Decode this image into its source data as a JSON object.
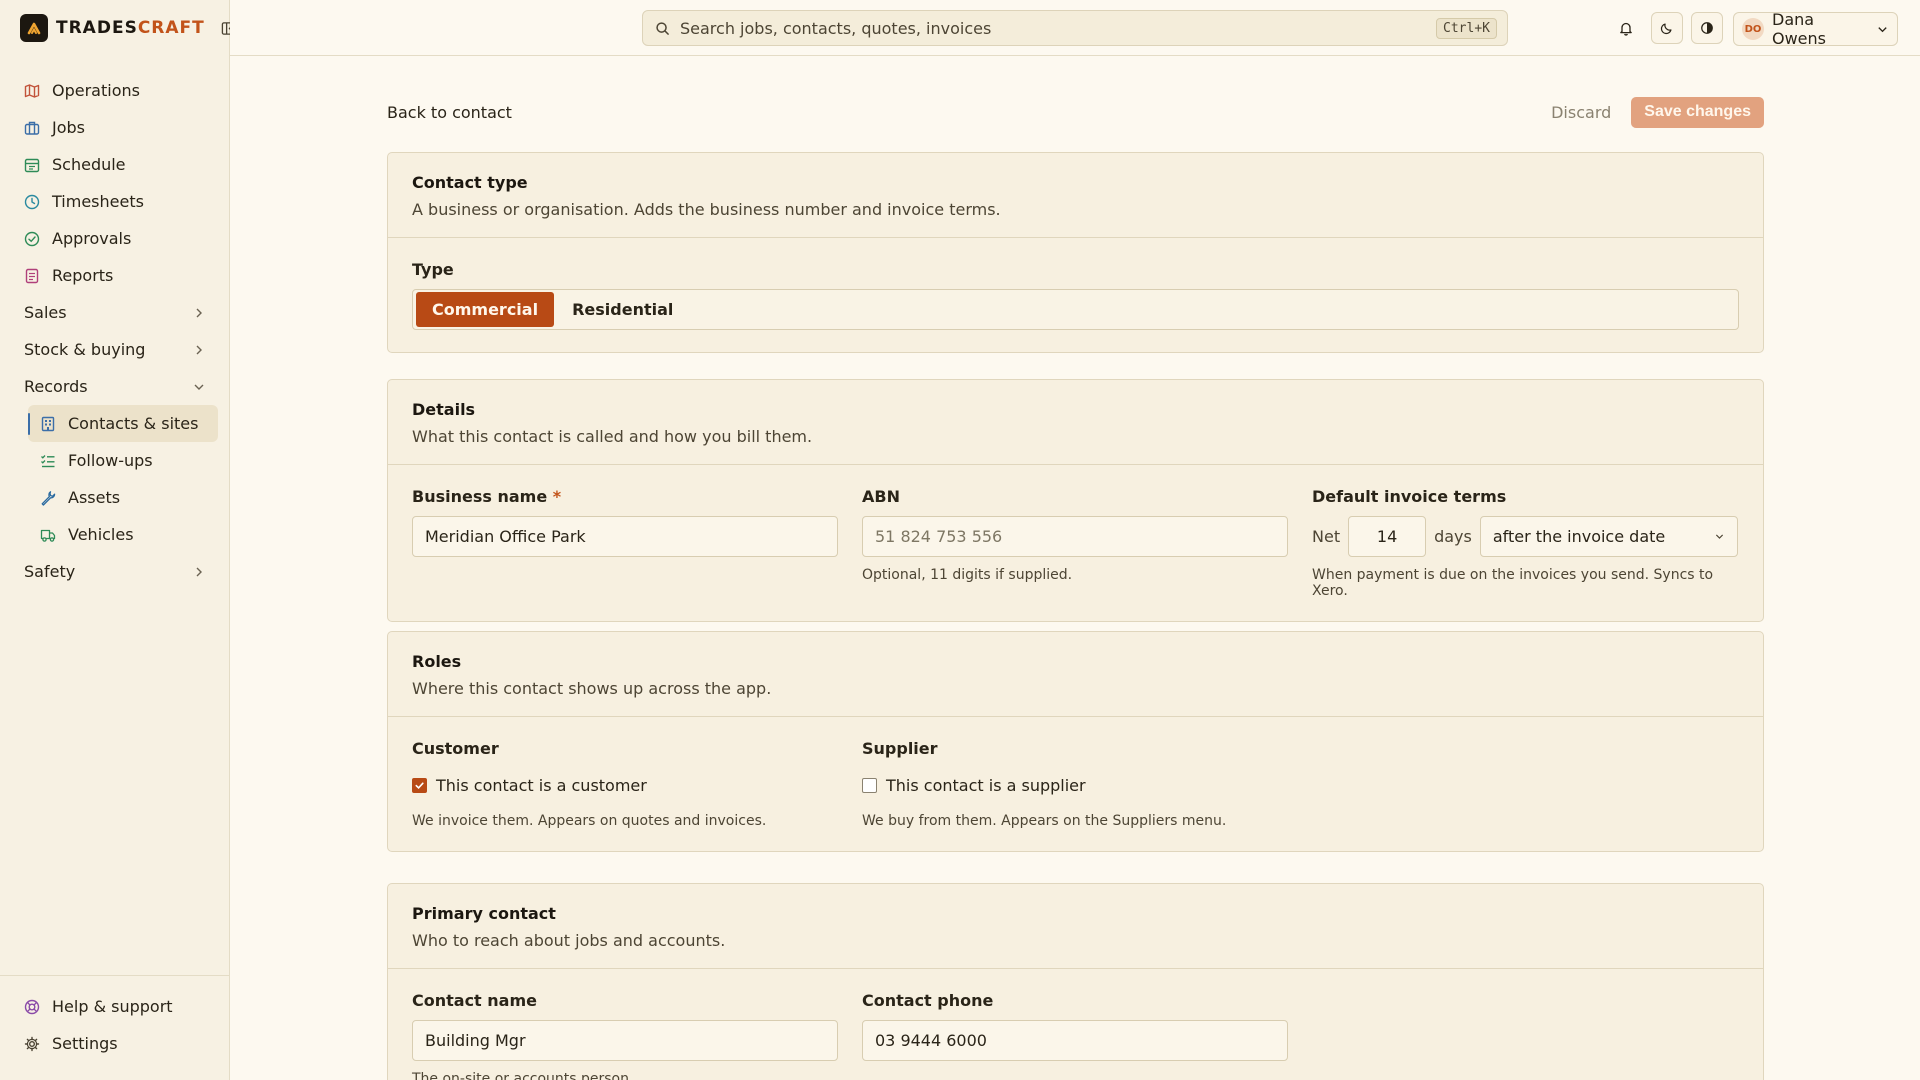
{
  "brand": {
    "name_a": "TRADES",
    "name_b": "CRAFT"
  },
  "nav": {
    "items": [
      {
        "label": "Operations"
      },
      {
        "label": "Jobs"
      },
      {
        "label": "Schedule"
      },
      {
        "label": "Timesheets"
      },
      {
        "label": "Approvals"
      },
      {
        "label": "Reports"
      }
    ],
    "groups": {
      "sales": "Sales",
      "stock": "Stock & buying",
      "records": "Records",
      "safety": "Safety"
    },
    "records_items": [
      {
        "label": "Contacts & sites"
      },
      {
        "label": "Follow-ups"
      },
      {
        "label": "Assets"
      },
      {
        "label": "Vehicles"
      }
    ],
    "bottom": [
      {
        "label": "Help & support"
      },
      {
        "label": "Settings"
      }
    ]
  },
  "topbar": {
    "search_placeholder": "Search jobs, contacts, quotes, invoices",
    "shortcut": "Ctrl+K",
    "user_initials": "DO",
    "user_name": "Dana Owens"
  },
  "page": {
    "back_label": "Back to contact",
    "discard_label": "Discard",
    "save_label": "Save changes"
  },
  "contact_type": {
    "title": "Contact type",
    "description": "A business or organisation. Adds the business number and invoice terms.",
    "field_label": "Type",
    "options": [
      "Commercial",
      "Residential"
    ],
    "selected": "Commercial"
  },
  "details": {
    "title": "Details",
    "description": "What this contact is called and how you bill them.",
    "business_name_label": "Business name",
    "required_mark": "*",
    "business_name_value": "Meridian Office Park",
    "abn_label": "ABN",
    "abn_placeholder": "51 824 753 556",
    "abn_hint": "Optional, 11 digits if supplied.",
    "terms_label": "Default invoice terms",
    "terms_prefix": "Net",
    "terms_days": "14",
    "terms_days_word": "days",
    "terms_basis": "after the invoice date",
    "terms_hint": "When payment is due on the invoices you send. Syncs to Xero."
  },
  "roles": {
    "title": "Roles",
    "description": "Where this contact shows up across the app.",
    "customer_label": "Customer",
    "customer_checkbox": "This contact is a customer",
    "customer_checked": true,
    "customer_hint": "We invoice them. Appears on quotes and invoices.",
    "supplier_label": "Supplier",
    "supplier_checkbox": "This contact is a supplier",
    "supplier_checked": false,
    "supplier_hint": "We buy from them. Appears on the Suppliers menu."
  },
  "primary_contact": {
    "title": "Primary contact",
    "description": "Who to reach about jobs and accounts.",
    "name_label": "Contact name",
    "name_value": "Building Mgr",
    "name_hint": "The on-site or accounts person.",
    "phone_label": "Contact phone",
    "phone_value": "03 9444 6000"
  },
  "colors": {
    "accent": "#b84a15",
    "accent_disabled": "#e2a27f",
    "background": "#fdf9f0",
    "sidebar": "#f7f1e3"
  }
}
